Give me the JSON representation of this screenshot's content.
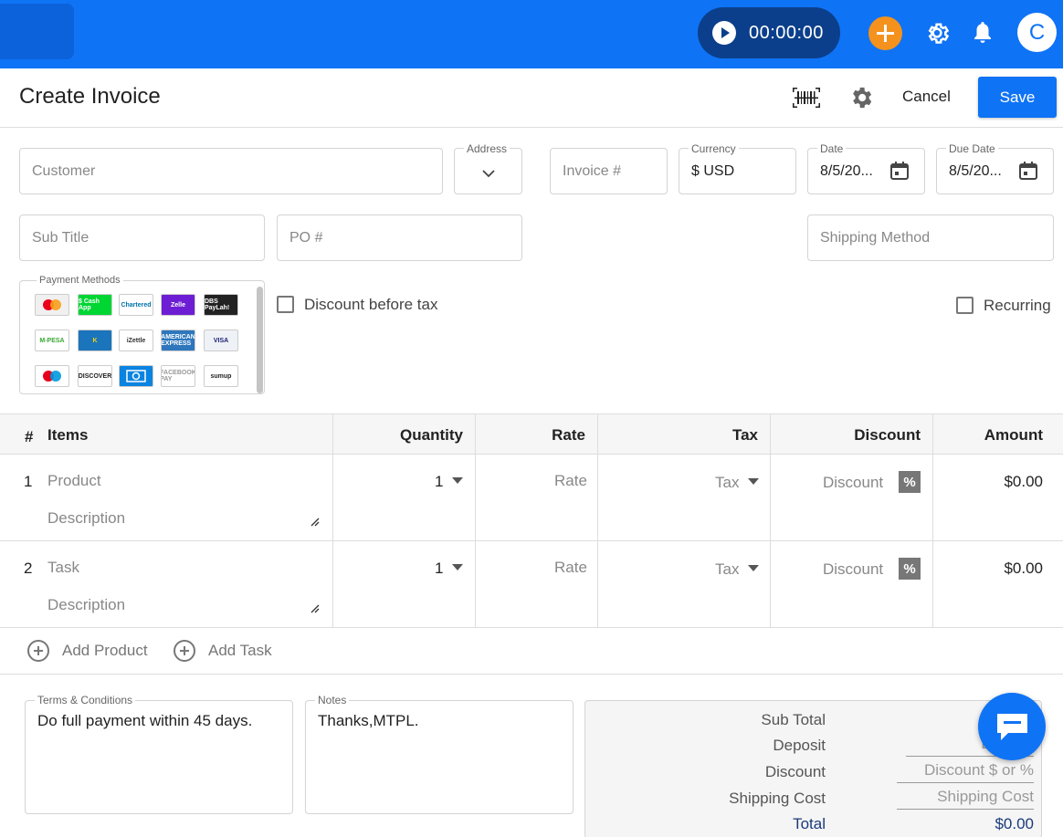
{
  "topbar": {
    "timer": "00:00:00",
    "avatar_initial": "C"
  },
  "header": {
    "title": "Create Invoice",
    "cancel_label": "Cancel",
    "save_label": "Save"
  },
  "form": {
    "customer_placeholder": "Customer",
    "address_label": "Address",
    "invoice_placeholder": "Invoice #",
    "currency_label": "Currency",
    "currency_value": "$ USD",
    "date_label": "Date",
    "date_value": "8/5/20...",
    "due_date_label": "Due Date",
    "due_date_value": "8/5/20...",
    "subtitle_placeholder": "Sub Title",
    "po_placeholder": "PO #",
    "shipping_method_placeholder": "Shipping Method",
    "payment_methods_label": "Payment Methods",
    "payment_methods": [
      {
        "name": "mastercard-icon",
        "text": "",
        "bg": "#f0f0f0",
        "fg": "#eb001b"
      },
      {
        "name": "cash-app-icon",
        "text": "$ Cash App",
        "bg": "#00d632",
        "fg": "#ffffff"
      },
      {
        "name": "standard-chartered-icon",
        "text": "Chartered",
        "bg": "#ffffff",
        "fg": "#0072aa"
      },
      {
        "name": "zelle-icon",
        "text": "Zelle",
        "bg": "#6d1ed4",
        "fg": "#ffffff"
      },
      {
        "name": "dbs-paylah-icon",
        "text": "DBS PayLah!",
        "bg": "#222222",
        "fg": "#ffffff"
      },
      {
        "name": "mpesa-icon",
        "text": "M-PESA",
        "bg": "#ffffff",
        "fg": "#3aa935"
      },
      {
        "name": "knet-icon",
        "text": "K",
        "bg": "#1b75bc",
        "fg": "#ffd200"
      },
      {
        "name": "izettle-icon",
        "text": "iZettle",
        "bg": "#ffffff",
        "fg": "#333333"
      },
      {
        "name": "american-express-icon",
        "text": "AMERICAN EXPRESS",
        "bg": "#2e77bc",
        "fg": "#ffffff"
      },
      {
        "name": "visa-icon",
        "text": "VISA",
        "bg": "#eef1f6",
        "fg": "#1a1f71"
      },
      {
        "name": "maestro-icon",
        "text": "",
        "bg": "#ffffff",
        "fg": "#0099df"
      },
      {
        "name": "discover-icon",
        "text": "DISCOVER",
        "bg": "#ffffff",
        "fg": "#222222"
      },
      {
        "name": "cash-icon",
        "text": "",
        "bg": "#0a84e0",
        "fg": "#ffffff"
      },
      {
        "name": "facebook-pay-icon",
        "text": "FACEBOOK PAY",
        "bg": "#ffffff",
        "fg": "#999999"
      },
      {
        "name": "sumup-icon",
        "text": "sumup",
        "bg": "#ffffff",
        "fg": "#222222"
      }
    ],
    "discount_before_tax_label": "Discount before tax",
    "recurring_label": "Recurring"
  },
  "table": {
    "headers": {
      "num": "#",
      "items": "Items",
      "quantity": "Quantity",
      "rate": "Rate",
      "tax": "Tax",
      "discount": "Discount",
      "amount": "Amount"
    },
    "rows": [
      {
        "num": "1",
        "item_placeholder": "Product",
        "desc_placeholder": "Description",
        "quantity": "1",
        "rate_placeholder": "Rate",
        "tax_placeholder": "Tax",
        "discount_placeholder": "Discount",
        "pct": "%",
        "amount": "$0.00"
      },
      {
        "num": "2",
        "item_placeholder": "Task",
        "desc_placeholder": "Description",
        "quantity": "1",
        "rate_placeholder": "Rate",
        "tax_placeholder": "Tax",
        "discount_placeholder": "Discount",
        "pct": "%",
        "amount": "$0.00"
      }
    ],
    "add_product_label": "Add Product",
    "add_task_label": "Add Task"
  },
  "footer": {
    "terms_label": "Terms & Conditions",
    "terms_value": "Do full payment within 45 days.",
    "notes_label": "Notes",
    "notes_value": "Thanks,MTPL.",
    "totals": {
      "subtotal_label": "Sub Total",
      "deposit_label": "Deposit",
      "deposit_placeholder": "Deposit",
      "discount_label": "Discount",
      "discount_placeholder": "Discount $ or %",
      "shipping_label": "Shipping Cost",
      "shipping_placeholder": "Shipping Cost",
      "total_label": "Total",
      "total_value": "$0.00"
    }
  },
  "colors": {
    "primary": "#0f73f5",
    "accent": "#f5921d",
    "timer_bg": "#0b3f8c"
  }
}
